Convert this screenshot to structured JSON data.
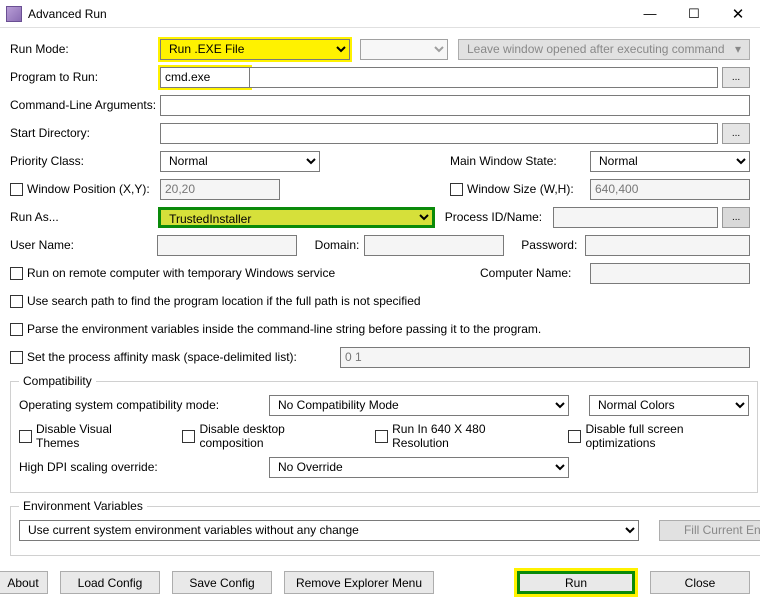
{
  "title": "Advanced Run",
  "win": {
    "min": "—",
    "max": "☐",
    "close": "✕"
  },
  "labels": {
    "runMode": "Run Mode:",
    "programToRun": "Program to Run:",
    "cmdArgs": "Command-Line Arguments:",
    "startDir": "Start Directory:",
    "priority": "Priority Class:",
    "mainWinState": "Main Window State:",
    "winPos": "Window Position (X,Y):",
    "winSize": "Window Size (W,H):",
    "runAs": "Run As...",
    "processId": "Process ID/Name:",
    "userName": "User Name:",
    "domain": "Domain:",
    "password": "Password:",
    "computerName": "Computer Name:"
  },
  "values": {
    "runMode": "Run .EXE File",
    "program": "cmd.exe",
    "cmdArgs": "",
    "startDir": "",
    "priority": "Normal",
    "mainWinState": "Normal",
    "winPos": "20,20",
    "winSize": "640,400",
    "runAs": "TrustedInstaller",
    "processId": "",
    "userName": "",
    "domain": "",
    "password": "",
    "computerName": "",
    "affinity": "0 1"
  },
  "leaveWindow": "Leave window opened after executing command",
  "checks": {
    "remote": "Run on remote computer with temporary Windows service",
    "searchPath": "Use search path to find the program location if the full path is not specified",
    "parseEnv": "Parse the environment variables inside the command-line string before passing it to the program.",
    "affinity": "Set the process affinity mask (space-delimited list):"
  },
  "compat": {
    "legend": "Compatibility",
    "osMode": "Operating system compatibility mode:",
    "osModeVal": "No Compatibility Mode",
    "colors": "Normal Colors",
    "disableThemes": "Disable Visual Themes",
    "disableComp": "Disable desktop composition",
    "run640": "Run In 640 X 480 Resolution",
    "disableFull": "Disable full screen optimizations",
    "hiDpi": "High DPI scaling override:",
    "hiDpiVal": "No Override"
  },
  "env": {
    "legend": "Environment Variables",
    "mode": "Use current system environment variables without any change",
    "fill": "Fill Current Environment Strings"
  },
  "buttons": {
    "about": "About",
    "load": "Load Config",
    "save": "Save Config",
    "remove": "Remove Explorer Menu",
    "run": "Run",
    "close": "Close"
  },
  "dots": "..."
}
